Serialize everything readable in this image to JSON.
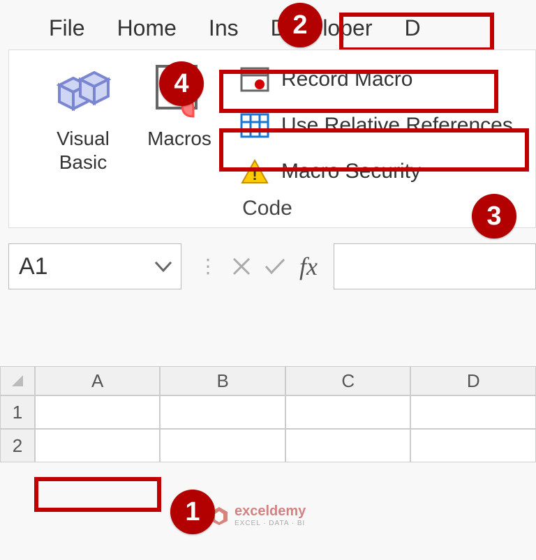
{
  "tabs": {
    "file": "File",
    "home": "Home",
    "insert": "Ins",
    "developer": "Developer",
    "next": "D"
  },
  "ribbon": {
    "visual_basic": "Visual\nBasic",
    "macros": "Macros",
    "record_macro": "Record Macro",
    "relative_refs": "Use Relative References",
    "macro_security": "Macro Security",
    "group": "Code"
  },
  "formulabar": {
    "namebox": "A1",
    "fx": "fx"
  },
  "grid": {
    "cols": [
      "A",
      "B",
      "C",
      "D"
    ],
    "rows": [
      "1",
      "2"
    ]
  },
  "markers": {
    "m1": "1",
    "m2": "2",
    "m3": "3",
    "m4": "4"
  },
  "watermark": {
    "name": "exceldemy",
    "sub": "EXCEL · DATA · BI"
  }
}
